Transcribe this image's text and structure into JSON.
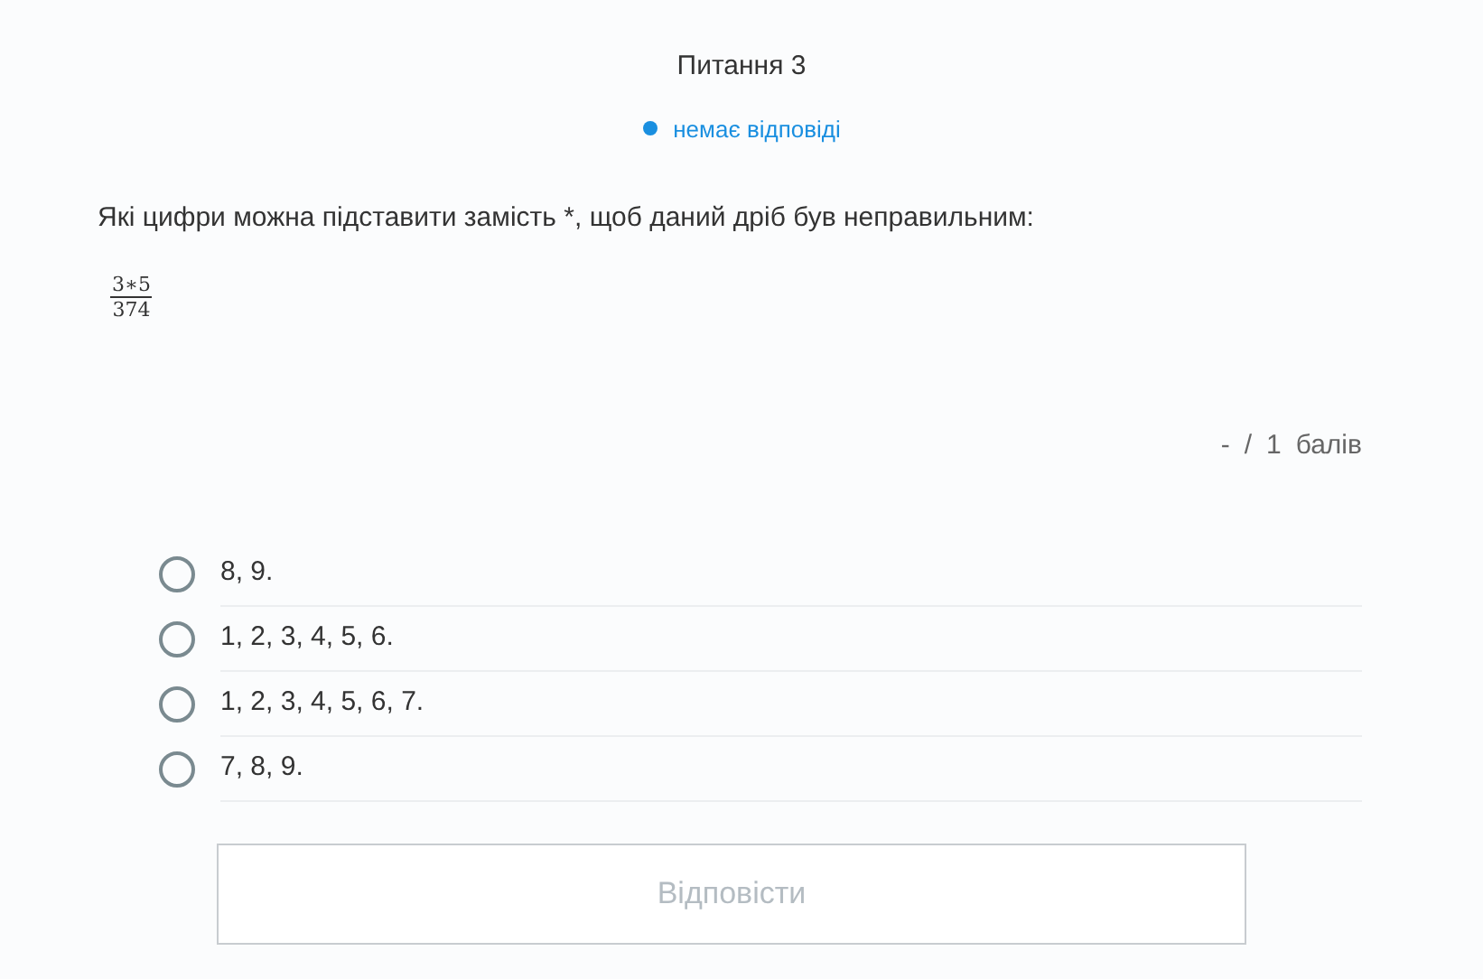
{
  "question": {
    "title": "Питання 3",
    "status": "немає відповіді",
    "text": "Які цифри можна підставити замість *, щоб даний дріб був неправильним:",
    "fraction": {
      "numerator": "3∗5",
      "denominator": "374"
    }
  },
  "score": {
    "value": "-",
    "separator": "/",
    "max": "1",
    "unit": "балів"
  },
  "options": [
    {
      "label": "8, 9.",
      "selected": false
    },
    {
      "label": "1, 2, 3, 4, 5, 6.",
      "selected": false
    },
    {
      "label": "1, 2, 3, 4, 5, 6, 7.",
      "selected": false
    },
    {
      "label": "7, 8, 9.",
      "selected": false
    }
  ],
  "submit": {
    "label": "Відповісти",
    "disabled": true
  }
}
